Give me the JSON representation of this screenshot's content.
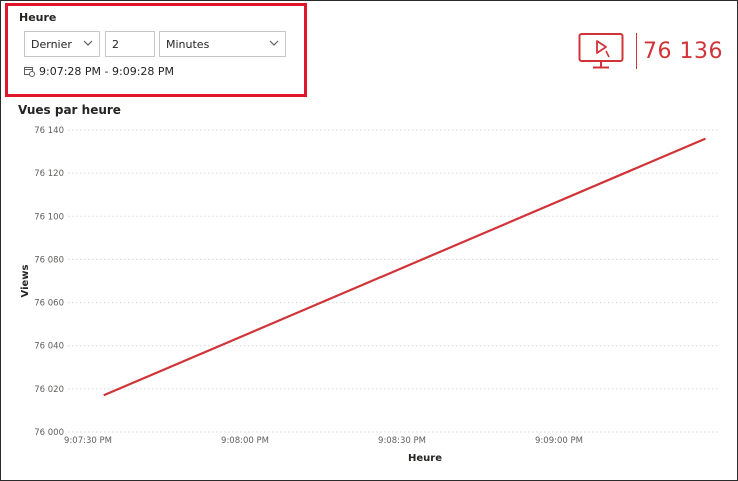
{
  "slicer": {
    "title": "Heure",
    "mode_value": "Dernier",
    "count_value": "2",
    "unit_value": "Minutes",
    "range_text": "9:07:28 PM - 9:09:28 PM"
  },
  "card": {
    "value": "76 136",
    "icon": "monitor-play-icon",
    "accent": "#d13438"
  },
  "chart_title": "Vues par heure",
  "chart_data": {
    "type": "line",
    "title": "Vues par heure",
    "xlabel": "Heure",
    "ylabel": "Views",
    "x_tick_labels": [
      "9:07:30 PM",
      "9:08:00 PM",
      "9:08:30 PM",
      "9:09:00 PM"
    ],
    "x_ticks_seconds_from_start": [
      0,
      30,
      60,
      90
    ],
    "y_tick_labels": [
      "76 000",
      "76 020",
      "76 040",
      "76 060",
      "76 080",
      "76 100",
      "76 120",
      "76 140"
    ],
    "ylim": [
      76000,
      76140
    ],
    "grid": true,
    "color": "#d13438",
    "series": [
      {
        "x": [
          "9:07:33 PM",
          "9:09:28 PM"
        ],
        "values": [
          76017,
          76136
        ]
      }
    ]
  }
}
